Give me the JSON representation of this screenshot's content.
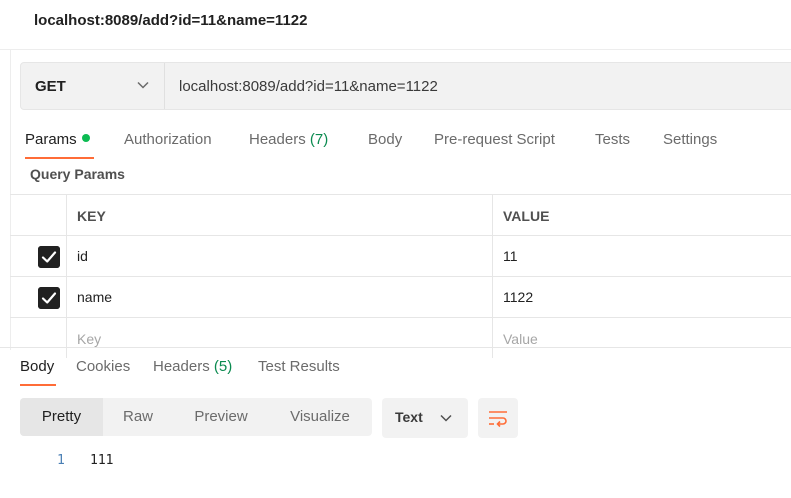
{
  "request": {
    "title": "localhost:8089/add?id=11&name=1122",
    "method": "GET",
    "url": "localhost:8089/add?id=11&name=1122"
  },
  "request_tabs": {
    "params": "Params",
    "authorization": "Authorization",
    "headers": "Headers",
    "headers_count": "(7)",
    "body": "Body",
    "prerequest": "Pre-request Script",
    "tests": "Tests",
    "settings": "Settings"
  },
  "query_params": {
    "title": "Query Params",
    "columns": {
      "key": "KEY",
      "value": "VALUE"
    },
    "rows": [
      {
        "checked": true,
        "key": "id",
        "value": "11"
      },
      {
        "checked": true,
        "key": "name",
        "value": "1122"
      }
    ],
    "placeholder_key": "Key",
    "placeholder_value": "Value"
  },
  "response_tabs": {
    "body": "Body",
    "cookies": "Cookies",
    "headers": "Headers",
    "headers_count": "(5)",
    "test_results": "Test Results"
  },
  "view_modes": [
    "Pretty",
    "Raw",
    "Preview",
    "Visualize"
  ],
  "format": "Text",
  "response_body": {
    "line": "1",
    "text": "111"
  },
  "icons": {
    "method_dropdown": "chevron-down-icon",
    "format_dropdown": "chevron-down-icon",
    "wrap": "wrap-lines-icon",
    "checkbox": "checkbox-checked-icon"
  },
  "colors": {
    "accent": "#ff6c37",
    "status_dot": "#0cbb52",
    "count_green": "#0a8a4f",
    "checkbox": "#212121",
    "line_number": "#4a7fb5"
  }
}
